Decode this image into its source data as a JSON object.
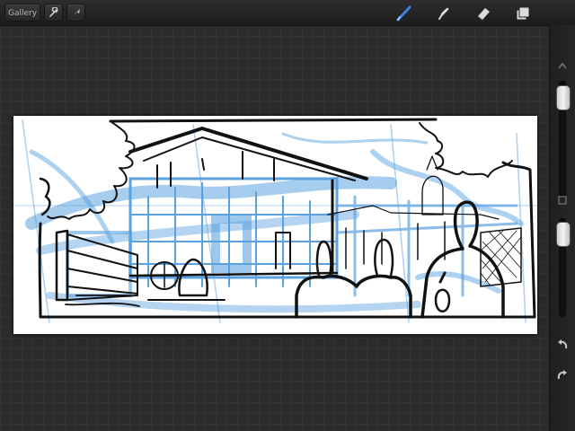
{
  "toolbar": {
    "gallery_label": "Gallery",
    "tools": {
      "active_tool": "brush-icon",
      "active_color": "#3f7fe0",
      "icons": [
        "brush-icon",
        "smudge-icon",
        "eraser-icon",
        "layers-icon"
      ]
    },
    "left_icons": [
      "wrench-icon",
      "actions-icon"
    ]
  },
  "sidebar": {
    "brush_size_level": 0.95,
    "opacity_level": 0.95,
    "icons": [
      "undo-icon",
      "redo-icon",
      "modify-icon"
    ]
  },
  "canvas": {
    "background": "#ffffff",
    "sketch_ink": "#111111",
    "sketch_blue": "#4a97dd"
  },
  "workspace": {
    "background": "#2b2b2b"
  }
}
